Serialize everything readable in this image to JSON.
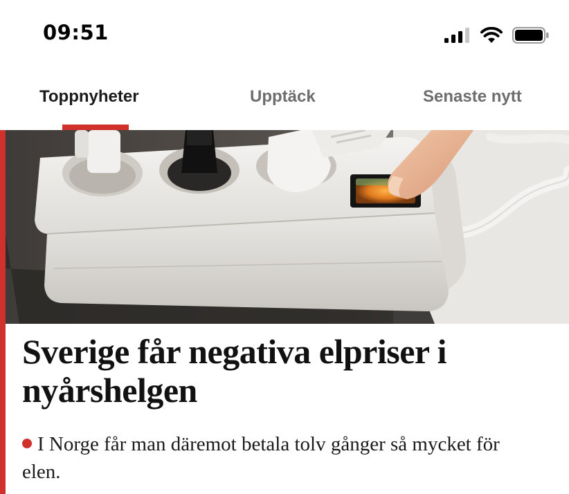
{
  "status_bar": {
    "time": "09:51",
    "icons": [
      "signal-icon",
      "wifi-icon",
      "battery-icon"
    ]
  },
  "tabs": [
    {
      "label": "Toppnyheter",
      "active": true
    },
    {
      "label": "Upptäck",
      "active": false
    },
    {
      "label": "Senaste nytt",
      "active": false
    }
  ],
  "article": {
    "headline": "Sverige får negativa elpriser i nyårshelgen",
    "lead": "I Norge får man däremot betala tolv gånger så mycket för elen."
  },
  "colors": {
    "accent": "#d0312d",
    "tab_active": "#1a1a1a",
    "tab_inactive": "#6d6d6d",
    "background": "#ffffff"
  }
}
